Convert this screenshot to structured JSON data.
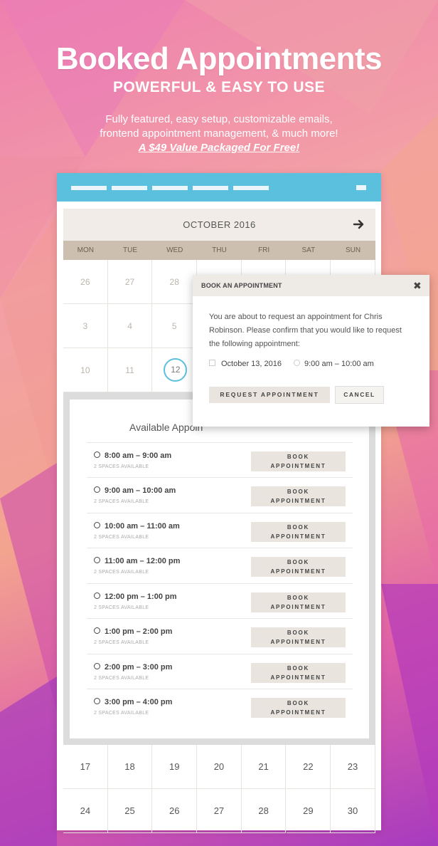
{
  "hero": {
    "title": "Booked Appointments",
    "subtitle": "POWERFUL & EASY TO USE",
    "desc_line1": "Fully featured, easy setup, customizable emails,",
    "desc_line2": "frontend appointment management, & much more!",
    "link": "A $49 Value Packaged For Free!"
  },
  "colors": {
    "topbar": "#5bc0de",
    "calendar_head": "#f1ece7",
    "weekday_bar": "#cdbfb0",
    "button_bg": "#e9e4de",
    "today_ring": "#5bc0de"
  },
  "calendar": {
    "month": "OCTOBER 2016",
    "next_icon": "arrow-right-icon",
    "weekdays": [
      "MON",
      "TUE",
      "WED",
      "THU",
      "FRI",
      "SAT",
      "SUN"
    ],
    "rows": [
      [
        "26",
        "27",
        "28",
        "",
        "",
        "",
        ""
      ],
      [
        "3",
        "4",
        "5",
        "",
        "",
        "",
        ""
      ],
      [
        "10",
        "11",
        "12",
        "",
        "",
        "",
        ""
      ]
    ],
    "bottom_rows": [
      [
        "17",
        "18",
        "19",
        "20",
        "21",
        "22",
        "23"
      ],
      [
        "24",
        "25",
        "26",
        "27",
        "28",
        "29",
        "30"
      ]
    ]
  },
  "panel": {
    "title": "Available Appoin",
    "slots": [
      {
        "time": "8:00 am – 9:00 am",
        "spaces": "2 SPACES AVAILABLE",
        "btn1": "BOOK",
        "btn2": "APPOINTMENT"
      },
      {
        "time": "9:00 am – 10:00 am",
        "spaces": "2 SPACES AVAILABLE",
        "btn1": "BOOK",
        "btn2": "APPOINTMENT"
      },
      {
        "time": "10:00 am – 11:00 am",
        "spaces": "2 SPACES AVAILABLE",
        "btn1": "BOOK",
        "btn2": "APPOINTMENT"
      },
      {
        "time": "11:00 am – 12:00 pm",
        "spaces": "2 SPACES AVAILABLE",
        "btn1": "BOOK",
        "btn2": "APPOINTMENT"
      },
      {
        "time": "12:00 pm – 1:00 pm",
        "spaces": "2 SPACES AVAILABLE",
        "btn1": "BOOK",
        "btn2": "APPOINTMENT"
      },
      {
        "time": "1:00 pm – 2:00 pm",
        "spaces": "2 SPACES AVAILABLE",
        "btn1": "BOOK",
        "btn2": "APPOINTMENT"
      },
      {
        "time": "2:00 pm – 3:00 pm",
        "spaces": "2 SPACES AVAILABLE",
        "btn1": "BOOK",
        "btn2": "APPOINTMENT"
      },
      {
        "time": "3:00 pm – 4:00 pm",
        "spaces": "2 SPACES AVAILABLE",
        "btn1": "BOOK",
        "btn2": "APPOINTMENT"
      }
    ]
  },
  "modal": {
    "title": "BOOK AN APPOINTMENT",
    "close": "✖",
    "text_line1": "You are about to request an appointment for Chris",
    "text_line2": "Robinson. Please confirm that you would like to request",
    "text_line3": "the following appointment:",
    "date": "October 13, 2016",
    "time": "9:00 am – 10:00 am",
    "request_btn": "REQUEST APPOINTMENT",
    "cancel_btn": "CANCEL"
  }
}
